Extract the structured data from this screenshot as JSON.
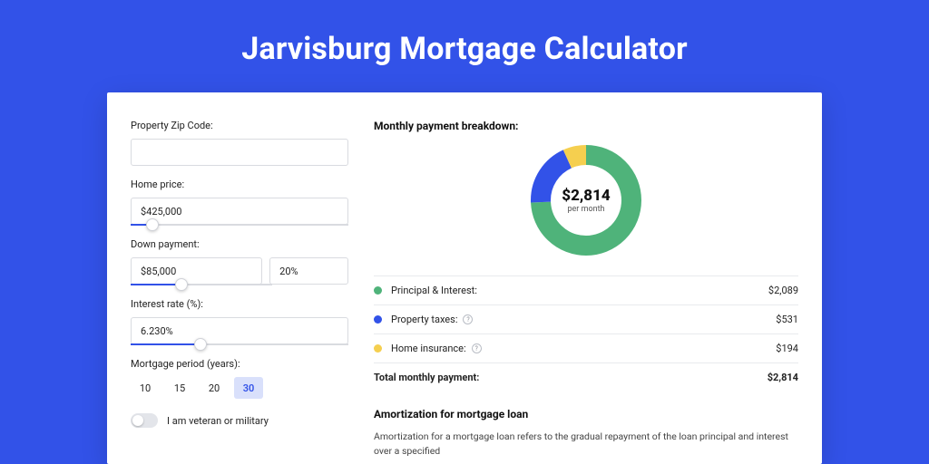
{
  "title": "Jarvisburg Mortgage Calculator",
  "form": {
    "zip": {
      "label": "Property Zip Code:",
      "value": ""
    },
    "price": {
      "label": "Home price:",
      "value": "$425,000",
      "slider_pct": 10
    },
    "down": {
      "label": "Down payment:",
      "value": "$85,000",
      "pct": "20%",
      "slider_pct": 24
    },
    "rate": {
      "label": "Interest rate (%):",
      "value": "6.230%",
      "slider_pct": 32
    },
    "period": {
      "label": "Mortgage period (years):",
      "options": [
        "10",
        "15",
        "20",
        "30"
      ],
      "selected": "30"
    },
    "veteran": {
      "label": "I am veteran or military",
      "checked": false
    }
  },
  "breakdown": {
    "title": "Monthly payment breakdown:",
    "total_display": "$2,814",
    "subtext": "per month",
    "items": [
      {
        "label": "Principal & Interest:",
        "amount": "$2,089",
        "color": "#4fb37a",
        "info": false
      },
      {
        "label": "Property taxes:",
        "amount": "$531",
        "color": "#3252e8",
        "info": true
      },
      {
        "label": "Home insurance:",
        "amount": "$194",
        "color": "#f5cf4f",
        "info": true
      }
    ],
    "total_row": {
      "label": "Total monthly payment:",
      "amount": "$2,814"
    }
  },
  "chart_data": {
    "type": "pie",
    "title": "Monthly payment breakdown",
    "series": [
      {
        "name": "Principal & Interest",
        "value": 2089,
        "color": "#4fb37a"
      },
      {
        "name": "Property taxes",
        "value": 531,
        "color": "#3252e8"
      },
      {
        "name": "Home insurance",
        "value": 194,
        "color": "#f5cf4f"
      }
    ],
    "total": 2814,
    "center_label": "$2,814 per month"
  },
  "amortization": {
    "title": "Amortization for mortgage loan",
    "body": "Amortization for a mortgage loan refers to the gradual repayment of the loan principal and interest over a specified"
  }
}
